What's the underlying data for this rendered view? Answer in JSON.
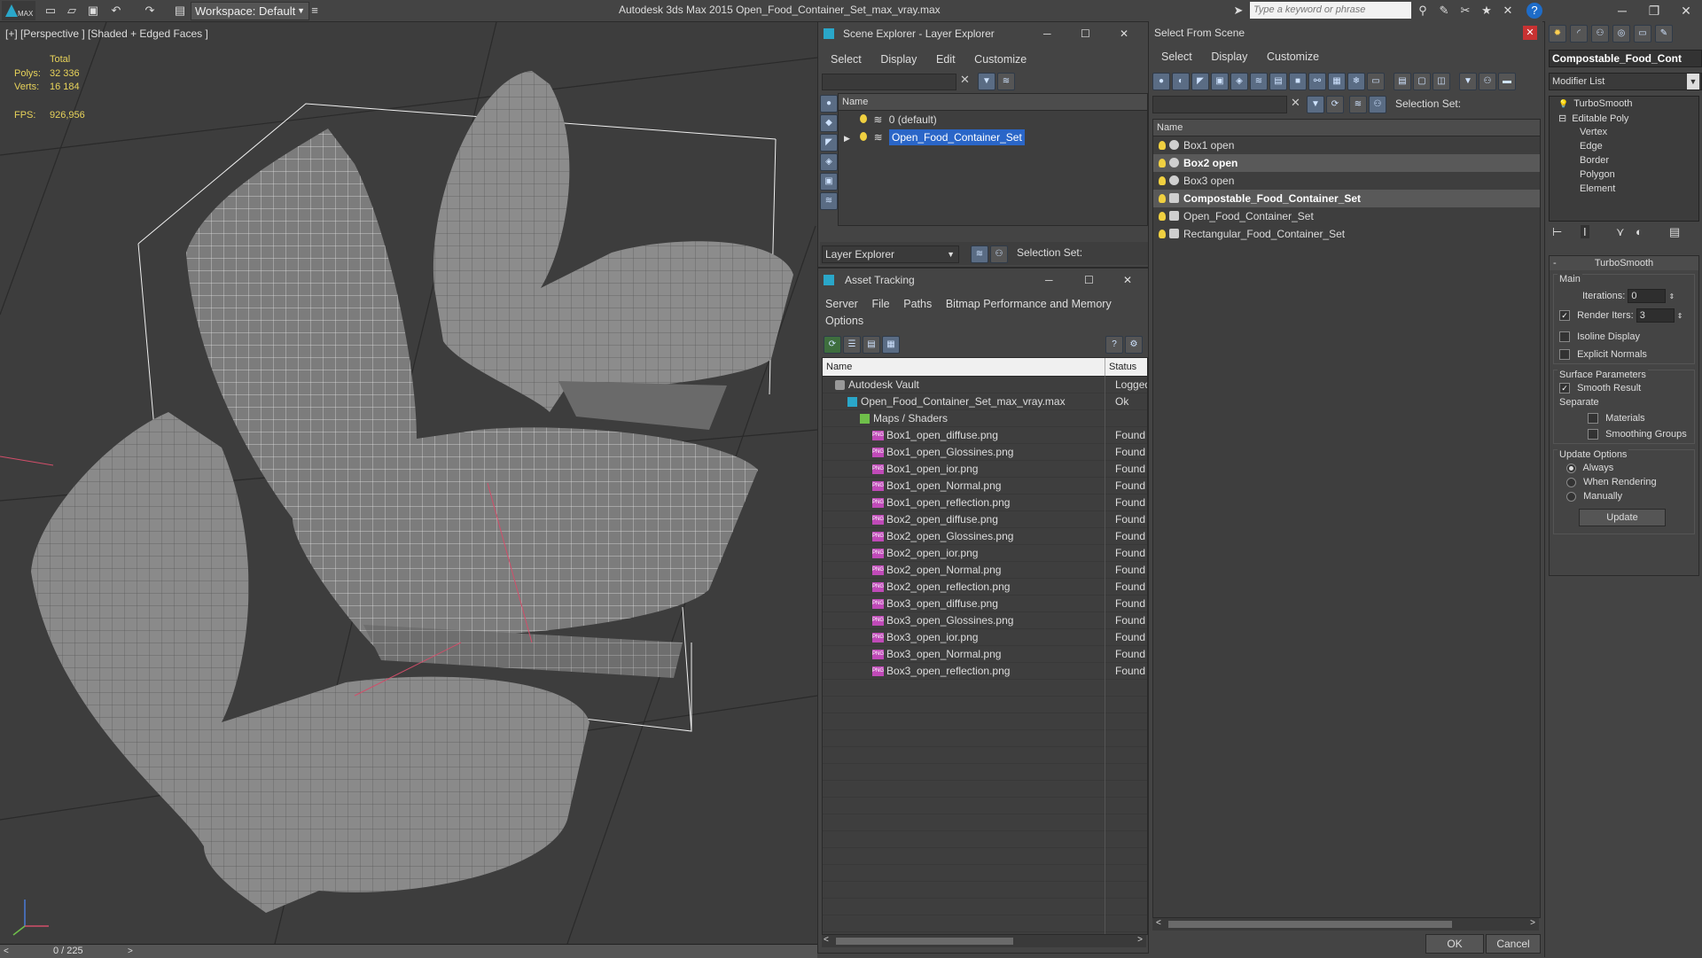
{
  "app": {
    "title": "Autodesk 3ds Max  2015     Open_Food_Container_Set_max_vray.max",
    "logo_text": "MAX",
    "workspace": "Workspace: Default",
    "search_placeholder": "Type a keyword or phrase"
  },
  "viewport": {
    "label": "[+] [Perspective ] [Shaded + Edged Faces ]",
    "stats": {
      "total_label": "Total",
      "polys_label": "Polys:",
      "polys_value": "32 336",
      "verts_label": "Verts:",
      "verts_value": "16 184",
      "fps_label": "FPS:",
      "fps_value": "926,956"
    },
    "timeline": "0 / 225"
  },
  "layer_explorer": {
    "title": "Scene Explorer - Layer Explorer",
    "menu": [
      "Select",
      "Display",
      "Edit",
      "Customize"
    ],
    "col_name": "Name",
    "rows": [
      {
        "label": "0 (default)",
        "selected": false
      },
      {
        "label": "Open_Food_Container_Set",
        "selected": true
      }
    ],
    "footer_dropdown": "Layer Explorer",
    "footer_selection": "Selection Set:"
  },
  "asset_tracking": {
    "title": "Asset Tracking",
    "menu": [
      "Server",
      "File",
      "Paths",
      "Bitmap Performance and Memory"
    ],
    "menu2": "Options",
    "col_name": "Name",
    "col_status": "Status",
    "rows": [
      {
        "name": "Autodesk Vault",
        "status": "Logged",
        "indent": 1
      },
      {
        "name": "Open_Food_Container_Set_max_vray.max",
        "status": "Ok",
        "indent": 2
      },
      {
        "name": "Maps / Shaders",
        "status": "",
        "indent": 3
      },
      {
        "name": "Box1_open_diffuse.png",
        "status": "Found",
        "indent": 4
      },
      {
        "name": "Box1_open_Glossines.png",
        "status": "Found",
        "indent": 4
      },
      {
        "name": "Box1_open_ior.png",
        "status": "Found",
        "indent": 4
      },
      {
        "name": "Box1_open_Normal.png",
        "status": "Found",
        "indent": 4
      },
      {
        "name": "Box1_open_reflection.png",
        "status": "Found",
        "indent": 4
      },
      {
        "name": "Box2_open_diffuse.png",
        "status": "Found",
        "indent": 4
      },
      {
        "name": "Box2_open_Glossines.png",
        "status": "Found",
        "indent": 4
      },
      {
        "name": "Box2_open_ior.png",
        "status": "Found",
        "indent": 4
      },
      {
        "name": "Box2_open_Normal.png",
        "status": "Found",
        "indent": 4
      },
      {
        "name": "Box2_open_reflection.png",
        "status": "Found",
        "indent": 4
      },
      {
        "name": "Box3_open_diffuse.png",
        "status": "Found",
        "indent": 4
      },
      {
        "name": "Box3_open_Glossines.png",
        "status": "Found",
        "indent": 4
      },
      {
        "name": "Box3_open_ior.png",
        "status": "Found",
        "indent": 4
      },
      {
        "name": "Box3_open_Normal.png",
        "status": "Found",
        "indent": 4
      },
      {
        "name": "Box3_open_reflection.png",
        "status": "Found",
        "indent": 4
      }
    ]
  },
  "select_from_scene": {
    "title": "Select From Scene",
    "menu": [
      "Select",
      "Display",
      "Customize"
    ],
    "selection_set": "Selection Set:",
    "col_name": "Name",
    "rows": [
      {
        "label": "Box1 open",
        "highlight": false
      },
      {
        "label": "Box2 open",
        "highlight": true
      },
      {
        "label": "Box3 open",
        "highlight": false
      },
      {
        "label": "Compostable_Food_Container_Set",
        "highlight": true
      },
      {
        "label": "Open_Food_Container_Set",
        "highlight": false
      },
      {
        "label": "Rectangular_Food_Container_Set",
        "highlight": false
      }
    ],
    "ok": "OK",
    "cancel": "Cancel"
  },
  "command_panel": {
    "object_name": "Compostable_Food_Cont",
    "modifier_list": "Modifier List",
    "stack": [
      "TurboSmooth",
      "Editable Poly",
      "Vertex",
      "Edge",
      "Border",
      "Polygon",
      "Element"
    ],
    "rollout_title": "TurboSmooth",
    "main_label": "Main",
    "iterations_label": "Iterations:",
    "iterations_value": "0",
    "render_iters_label": "Render Iters:",
    "render_iters_value": "3",
    "isoline": "Isoline Display",
    "explicit_normals": "Explicit Normals",
    "surface_params": "Surface Parameters",
    "smooth_result": "Smooth Result",
    "separate": "Separate",
    "materials": "Materials",
    "smoothing_groups": "Smoothing Groups",
    "update_options": "Update Options",
    "always": "Always",
    "when_rendering": "When Rendering",
    "manually": "Manually",
    "update_btn": "Update"
  }
}
